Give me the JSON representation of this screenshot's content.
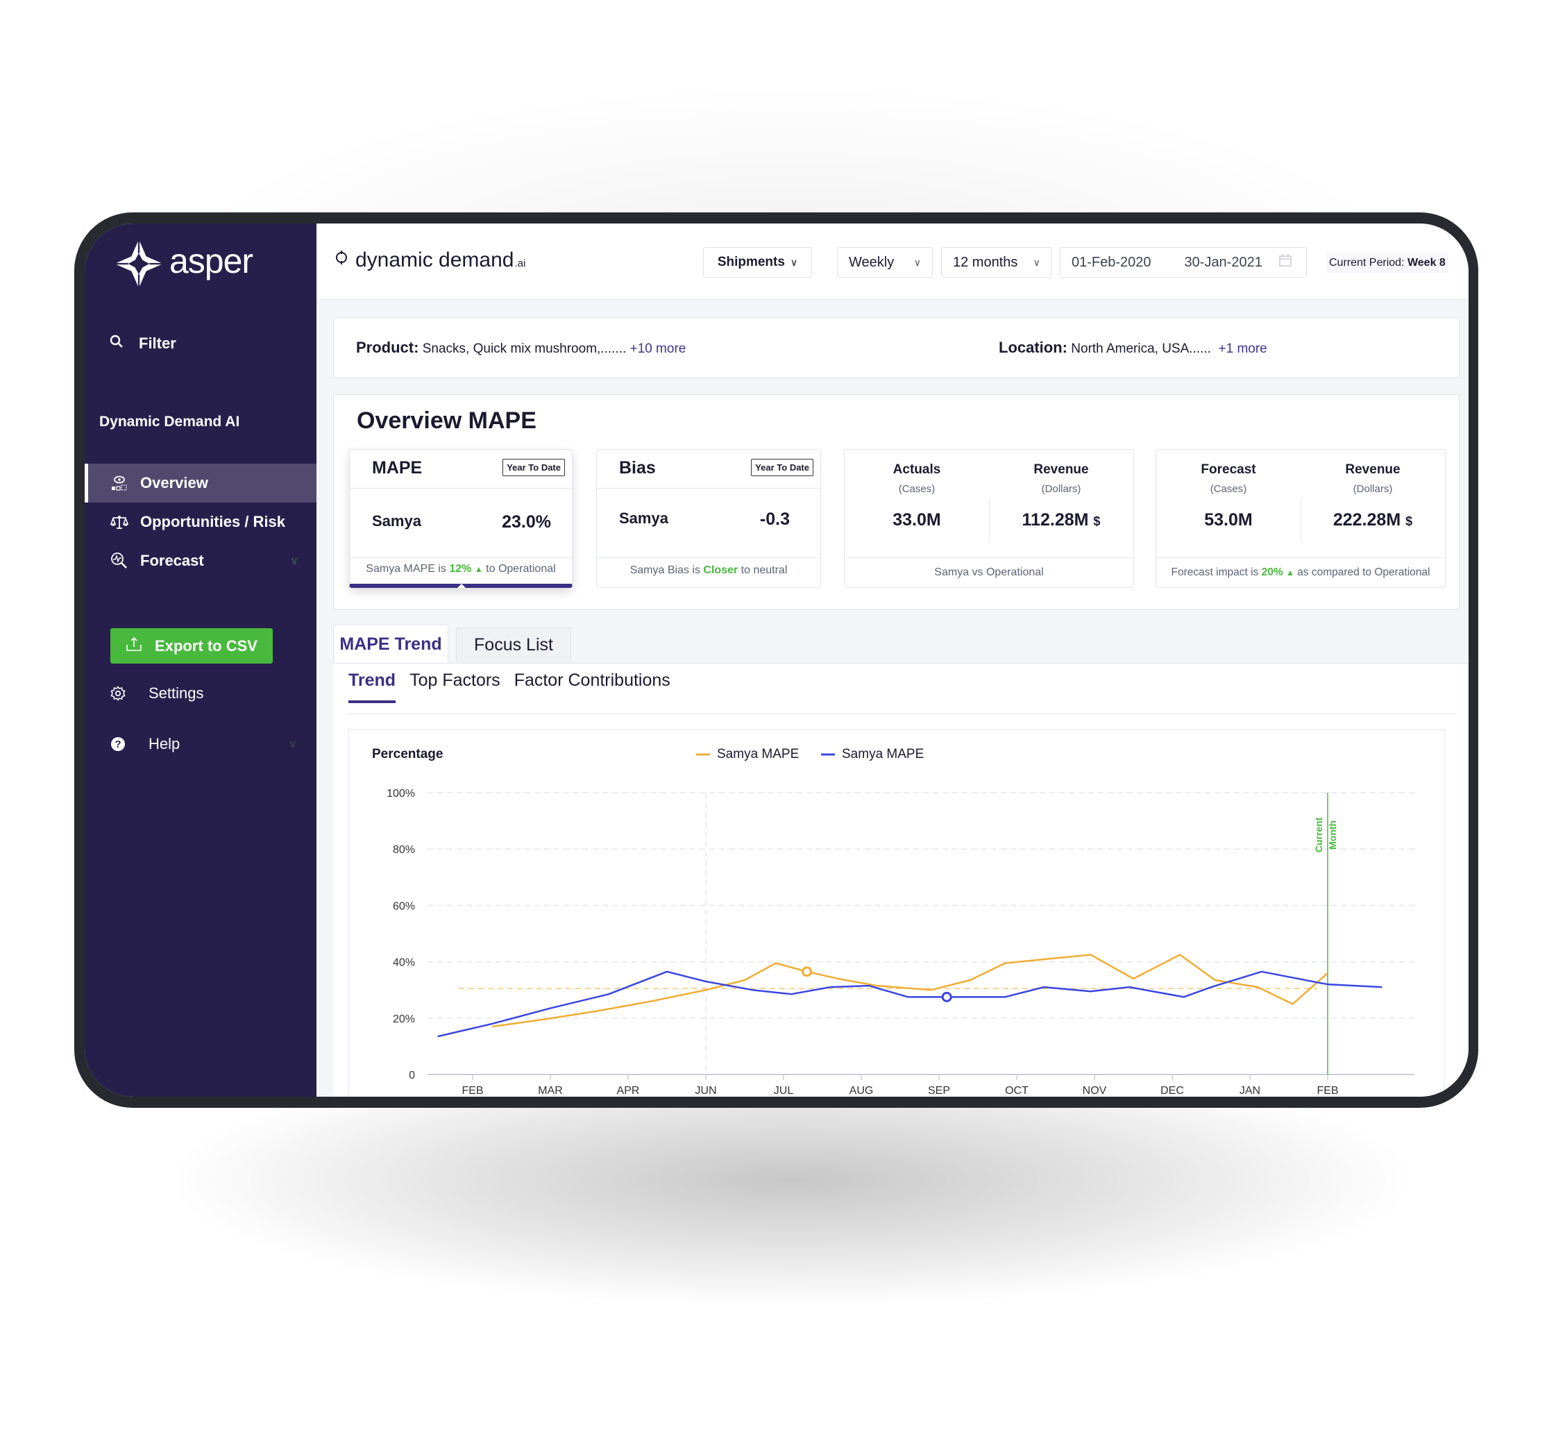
{
  "sidebar": {
    "brand": "asper",
    "filter_label": "Filter",
    "section_heading": "Dynamic Demand AI",
    "nav": [
      {
        "label": "Overview",
        "icon": "overview-eye-icon",
        "active": true
      },
      {
        "label": "Opportunities / Risk",
        "icon": "scales-icon",
        "active": false
      },
      {
        "label": "Forecast",
        "icon": "forecast-search-icon",
        "active": false
      }
    ],
    "export_label": "Export to CSV",
    "settings_label": "Settings",
    "help_label": "Help"
  },
  "topbar": {
    "app_name": "dynamic demand",
    "app_suffix": ".ai",
    "measure": "Shipments",
    "granularity": "Weekly",
    "horizon": "12 months",
    "date_from": "01-Feb-2020",
    "date_to": "30-Jan-2021",
    "period_label": "Current Period:",
    "period_value": "Week 8"
  },
  "filters": {
    "product_label": "Product:",
    "product_value": "Snacks, Quick mix mushroom,.......",
    "product_more": "+10 more",
    "location_label": "Location:",
    "location_value": "North America,  USA......",
    "location_more": "+1 more"
  },
  "overview": {
    "title": "Overview MAPE",
    "mape": {
      "title": "MAPE",
      "badge": "Year To Date",
      "label": "Samya",
      "value": "23.0%",
      "foot_pre": "Samya MAPE is",
      "foot_pct": "12%",
      "foot_post": "to Operational"
    },
    "bias": {
      "title": "Bias",
      "badge": "Year To Date",
      "label": "Samya",
      "value": "-0.3",
      "foot_pre": "Samya Bias is",
      "foot_hl": "Closer",
      "foot_post": "to neutral"
    },
    "actuals": {
      "col1_title": "Actuals",
      "col1_sub": "(Cases)",
      "col1_value": "33.0M",
      "col2_title": "Revenue",
      "col2_sub": "(Dollars)",
      "col2_value": "112.28M",
      "col2_unit": "$",
      "foot": "Samya vs Operational"
    },
    "forecast": {
      "col1_title": "Forecast",
      "col1_sub": "(Cases)",
      "col1_value": "53.0M",
      "col2_title": "Revenue",
      "col2_sub": "(Dollars)",
      "col2_value": "222.28M",
      "col2_unit": "$",
      "foot_pre": "Forecast  impact is",
      "foot_pct": "20%",
      "foot_post": "as compared to Operational"
    }
  },
  "tabs": [
    {
      "label": "MAPE Trend",
      "active": true
    },
    {
      "label": "Focus List",
      "active": false
    }
  ],
  "subtabs": [
    {
      "label": "Trend",
      "active": true
    },
    {
      "label": "Top Factors",
      "active": false
    },
    {
      "label": "Factor Contributions",
      "active": false
    }
  ],
  "colors": {
    "sidebar": "#271f4b",
    "accent": "#3b2f85",
    "green": "#48b93d",
    "orange": "#f0ad32",
    "blue": "#3a47e0"
  },
  "chart_data": {
    "type": "line",
    "title": "",
    "ylabel": "Percentage",
    "xlabel": "",
    "ylim": [
      0,
      100
    ],
    "yticks": [
      "0",
      "20%",
      "40%",
      "60%",
      "80%",
      "100%"
    ],
    "categories": [
      "FEB",
      "MAR",
      "APR",
      "JUN",
      "JUL",
      "AUG",
      "SEP",
      "OCT",
      "NOV",
      "DEC",
      "JAN",
      "FEB"
    ],
    "legend_position": "top-center",
    "grid": true,
    "series": [
      {
        "name": "Samya MAPE",
        "color": "#f0ad32",
        "x": [
          0.25,
          0.9,
          1.6,
          2.3,
          3.0,
          3.5,
          3.9,
          4.3,
          4.7,
          5.2,
          5.9,
          6.4,
          6.85,
          7.4,
          7.95,
          8.5,
          9.1,
          9.55,
          10.1,
          10.55,
          11.0
        ],
        "values": [
          17,
          19.5,
          22.5,
          26,
          30,
          33.5,
          39.5,
          36.5,
          34,
          31.5,
          30,
          33.5,
          39.5,
          41,
          42.5,
          34,
          42.5,
          33.5,
          31,
          25,
          36
        ],
        "highlight_index": 7
      },
      {
        "name": "Samya MAPE",
        "color": "#3a47e0",
        "x": [
          -0.45,
          0.25,
          1.0,
          1.75,
          2.5,
          3.0,
          3.6,
          4.1,
          4.6,
          5.1,
          5.6,
          6.1,
          6.85,
          7.35,
          7.95,
          8.45,
          9.15,
          9.5,
          10.15,
          10.9,
          11.0,
          11.7
        ],
        "values": [
          13.5,
          18,
          23.5,
          28.5,
          36.5,
          33,
          30,
          28.5,
          31,
          31.5,
          27.5,
          27.5,
          27.5,
          31,
          29.5,
          31,
          27.5,
          31,
          36.5,
          32.5,
          32,
          31
        ],
        "highlight_index": 11
      }
    ],
    "reference_line": {
      "value": 30.5,
      "color": "#f5c77a",
      "style": "dashed"
    },
    "vertical_guide": {
      "category_index": 3,
      "style": "dashed"
    },
    "current_marker": {
      "category_index": 11,
      "label_line1": "Current",
      "label_line2": "Month",
      "color": "#48b93d"
    }
  }
}
